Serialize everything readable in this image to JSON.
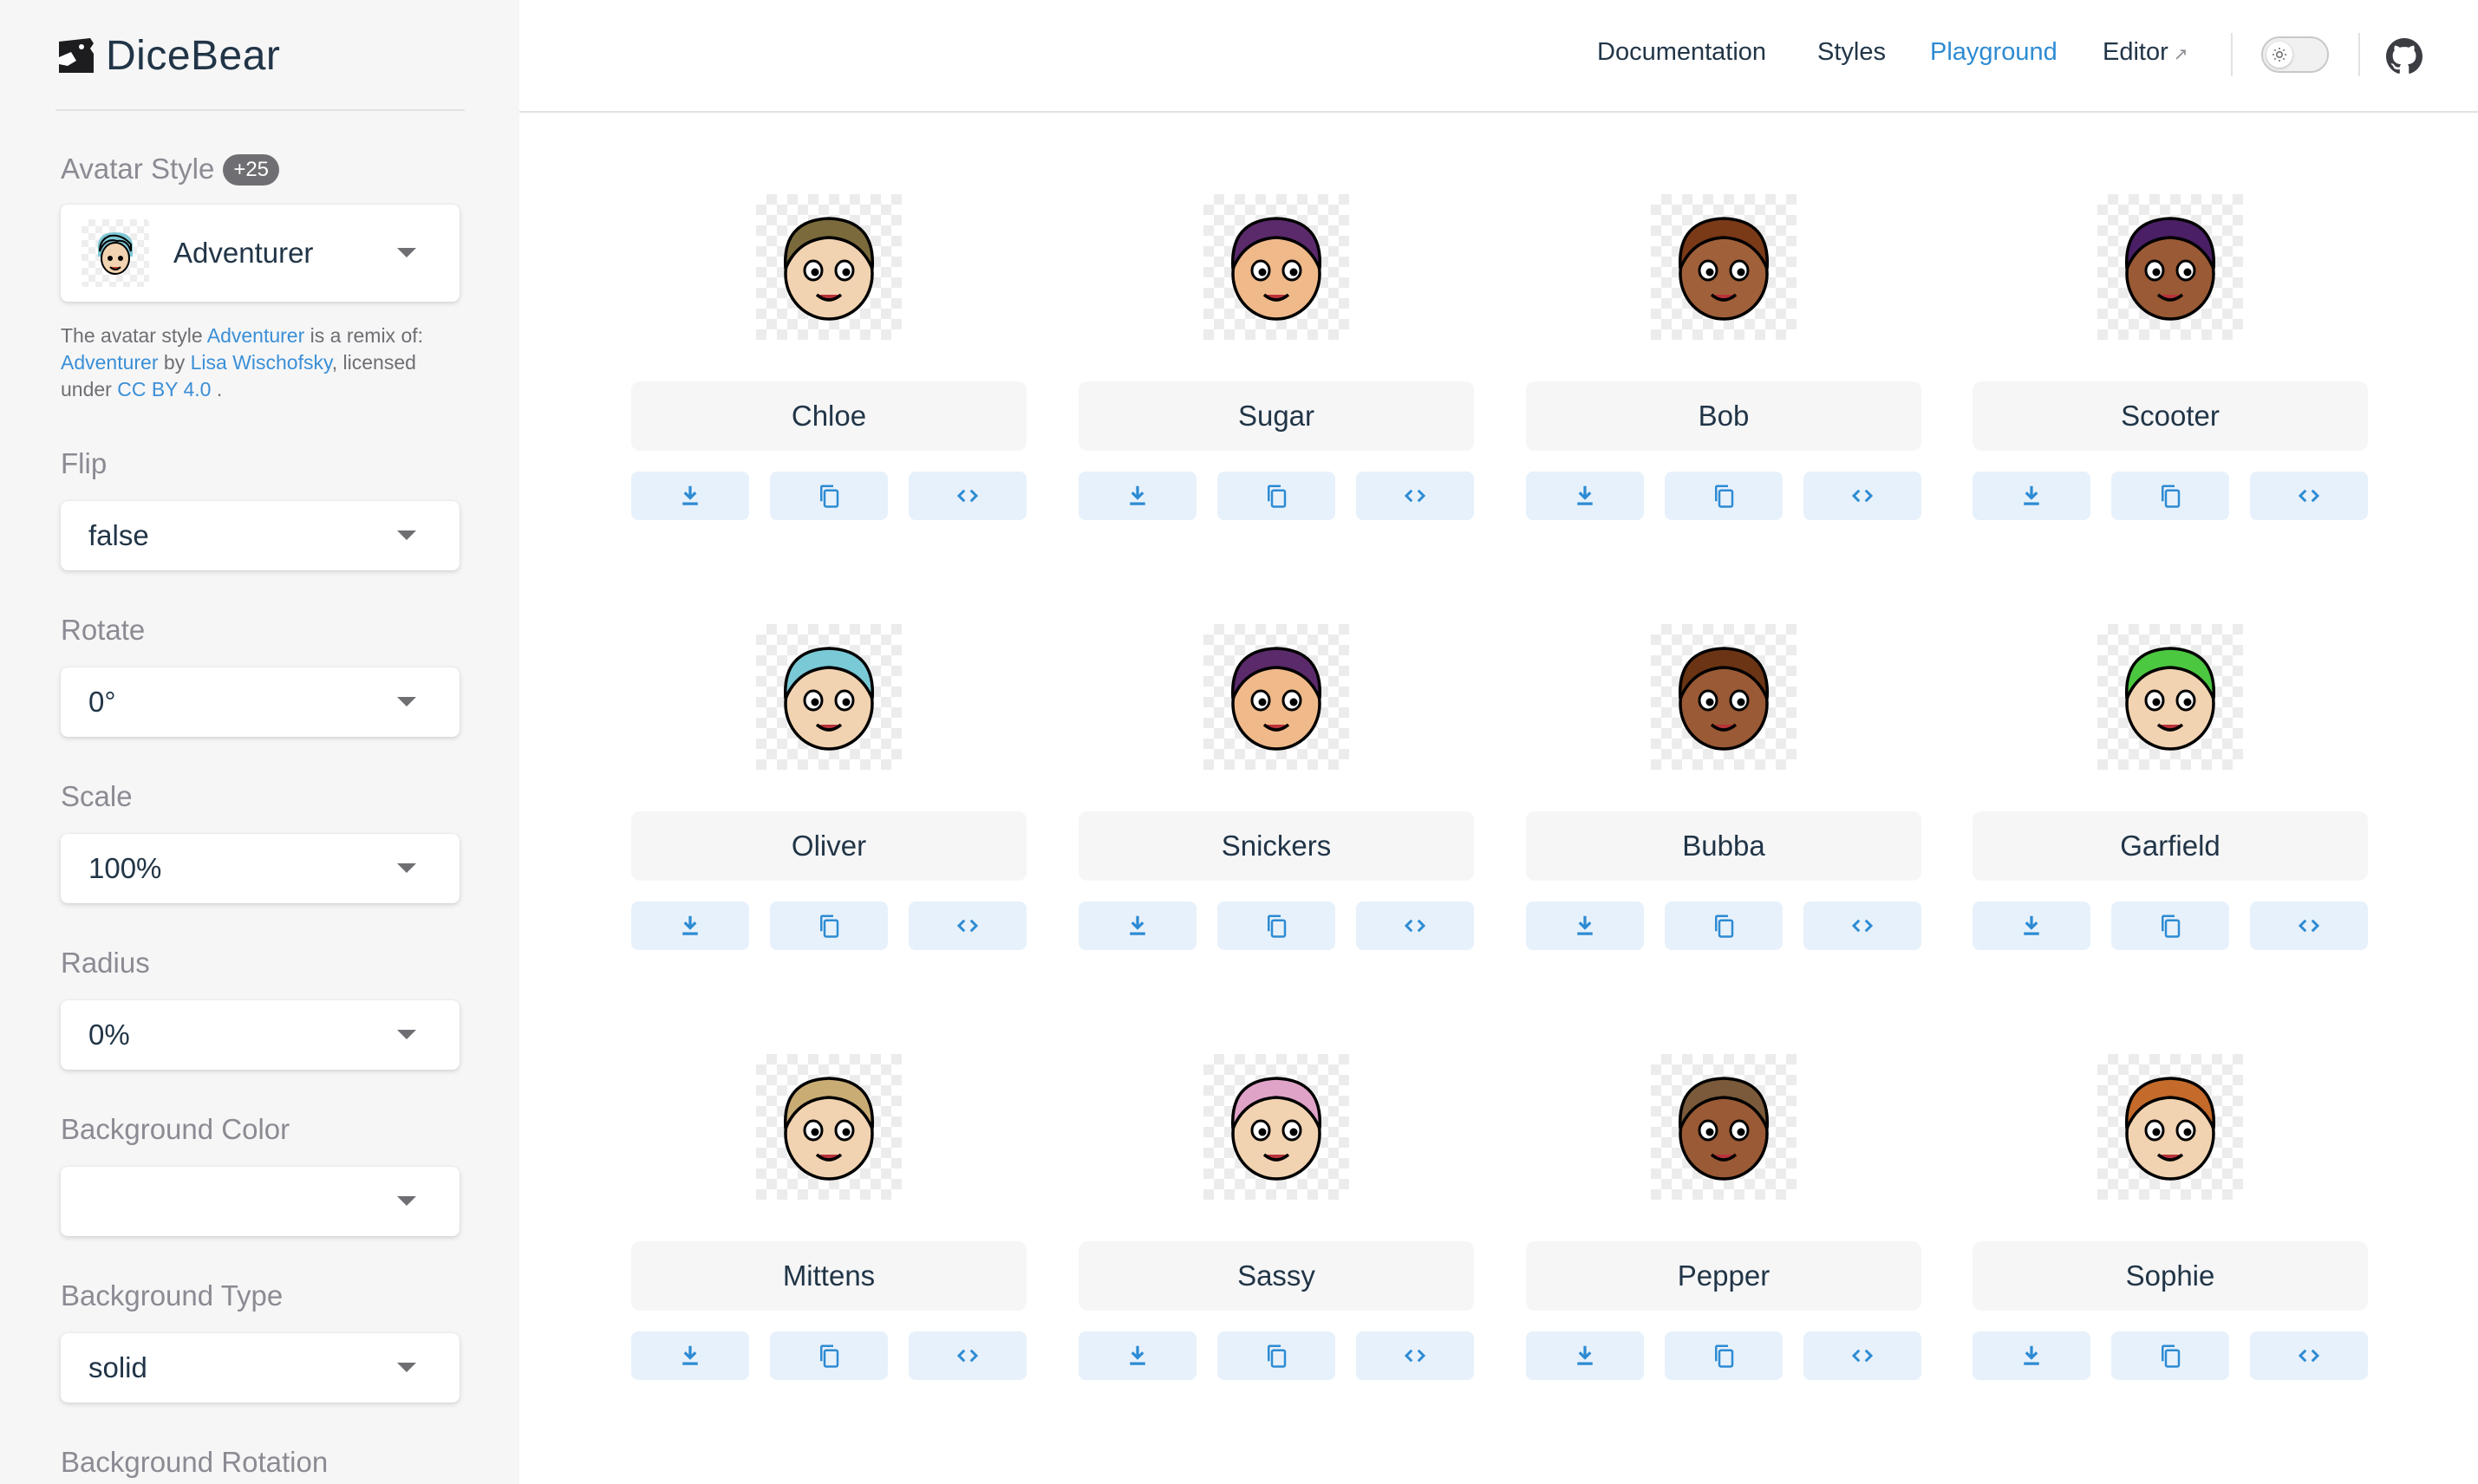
{
  "app": {
    "name": "DiceBear"
  },
  "nav": {
    "items": [
      {
        "label": "Documentation",
        "active": false
      },
      {
        "label": "Styles",
        "active": false
      },
      {
        "label": "Playground",
        "active": true
      },
      {
        "label": "Editor",
        "active": false,
        "external": true
      }
    ],
    "theme_toggle": "light",
    "icons": [
      "sun-icon",
      "github-icon"
    ]
  },
  "sidebar": {
    "avatar_style": {
      "label": "Avatar Style",
      "badge": "+25",
      "value": "Adventurer"
    },
    "description": {
      "t1": "The avatar style ",
      "l1": "Adventurer",
      "t2": " is a remix of: ",
      "l2": "Adventurer",
      "t3": " by ",
      "l3": "Lisa Wischofsky",
      "t4": ", licensed under ",
      "l4": "CC BY 4.0",
      "t5": " ."
    },
    "fields": [
      {
        "label": "Flip",
        "value": "false"
      },
      {
        "label": "Rotate",
        "value": "0°"
      },
      {
        "label": "Scale",
        "value": "100%"
      },
      {
        "label": "Radius",
        "value": "0%"
      },
      {
        "label": "Background Color",
        "value": ""
      },
      {
        "label": "Background Type",
        "value": "solid"
      },
      {
        "label": "Background Rotation",
        "value": ""
      }
    ]
  },
  "avatars": [
    {
      "name": "Chloe"
    },
    {
      "name": "Sugar"
    },
    {
      "name": "Bob"
    },
    {
      "name": "Scooter"
    },
    {
      "name": "Oliver"
    },
    {
      "name": "Snickers"
    },
    {
      "name": "Bubba"
    },
    {
      "name": "Garfield"
    },
    {
      "name": "Mittens"
    },
    {
      "name": "Sassy"
    },
    {
      "name": "Pepper"
    },
    {
      "name": "Sophie"
    }
  ],
  "actions": [
    "download-icon",
    "copy-icon",
    "code-icon"
  ],
  "colors": {
    "accent": "#2d8bd3",
    "sidebar_bg": "#f6f6f7",
    "action_bg": "#e7f1fb"
  }
}
